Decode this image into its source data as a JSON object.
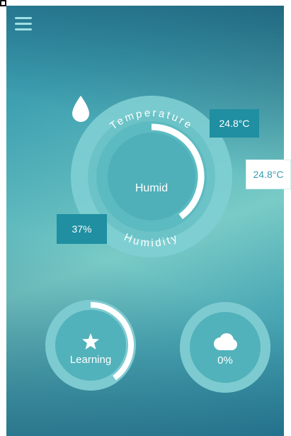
{
  "menu": {
    "icon": "hamburger-menu-icon"
  },
  "dial": {
    "arc_top_label": "Temperature",
    "arc_bottom_label": "Humidity",
    "center_label": "Humid",
    "center_icon": "water-drop-icon",
    "temperature_progress": 0.4,
    "humidity_progress": 0.37
  },
  "callouts": {
    "temperature": "24.8°C",
    "temperature_secondary": "24.8°C",
    "humidity": "37%"
  },
  "buttons": {
    "learning": {
      "label": "Learning",
      "icon": "star-icon",
      "progress": 0.4
    },
    "weather": {
      "label": "0%",
      "icon": "cloud-icon"
    }
  },
  "colors": {
    "accent": "#1f8fa1",
    "progress_arc": "#ffffff",
    "dial_ring": "#7fcfd3",
    "dial_core": "#4fb0b9"
  }
}
